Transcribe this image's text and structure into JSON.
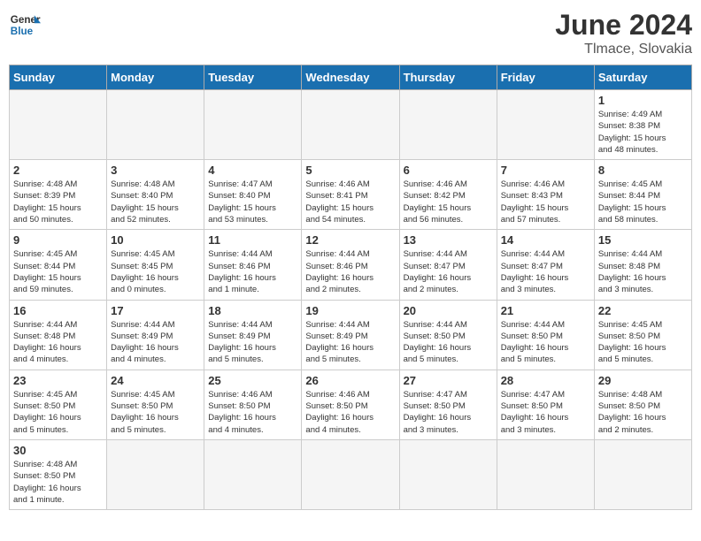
{
  "header": {
    "logo_general": "General",
    "logo_blue": "Blue",
    "title": "June 2024",
    "subtitle": "Tlmace, Slovakia"
  },
  "weekdays": [
    "Sunday",
    "Monday",
    "Tuesday",
    "Wednesday",
    "Thursday",
    "Friday",
    "Saturday"
  ],
  "weeks": [
    [
      {
        "day": "",
        "info": "",
        "empty": true
      },
      {
        "day": "",
        "info": "",
        "empty": true
      },
      {
        "day": "",
        "info": "",
        "empty": true
      },
      {
        "day": "",
        "info": "",
        "empty": true
      },
      {
        "day": "",
        "info": "",
        "empty": true
      },
      {
        "day": "",
        "info": "",
        "empty": true
      },
      {
        "day": "1",
        "info": "Sunrise: 4:49 AM\nSunset: 8:38 PM\nDaylight: 15 hours\nand 48 minutes."
      }
    ],
    [
      {
        "day": "2",
        "info": "Sunrise: 4:48 AM\nSunset: 8:39 PM\nDaylight: 15 hours\nand 50 minutes."
      },
      {
        "day": "3",
        "info": "Sunrise: 4:48 AM\nSunset: 8:40 PM\nDaylight: 15 hours\nand 52 minutes."
      },
      {
        "day": "4",
        "info": "Sunrise: 4:47 AM\nSunset: 8:40 PM\nDaylight: 15 hours\nand 53 minutes."
      },
      {
        "day": "5",
        "info": "Sunrise: 4:46 AM\nSunset: 8:41 PM\nDaylight: 15 hours\nand 54 minutes."
      },
      {
        "day": "6",
        "info": "Sunrise: 4:46 AM\nSunset: 8:42 PM\nDaylight: 15 hours\nand 56 minutes."
      },
      {
        "day": "7",
        "info": "Sunrise: 4:46 AM\nSunset: 8:43 PM\nDaylight: 15 hours\nand 57 minutes."
      },
      {
        "day": "8",
        "info": "Sunrise: 4:45 AM\nSunset: 8:44 PM\nDaylight: 15 hours\nand 58 minutes."
      }
    ],
    [
      {
        "day": "9",
        "info": "Sunrise: 4:45 AM\nSunset: 8:44 PM\nDaylight: 15 hours\nand 59 minutes."
      },
      {
        "day": "10",
        "info": "Sunrise: 4:45 AM\nSunset: 8:45 PM\nDaylight: 16 hours\nand 0 minutes."
      },
      {
        "day": "11",
        "info": "Sunrise: 4:44 AM\nSunset: 8:46 PM\nDaylight: 16 hours\nand 1 minute."
      },
      {
        "day": "12",
        "info": "Sunrise: 4:44 AM\nSunset: 8:46 PM\nDaylight: 16 hours\nand 2 minutes."
      },
      {
        "day": "13",
        "info": "Sunrise: 4:44 AM\nSunset: 8:47 PM\nDaylight: 16 hours\nand 2 minutes."
      },
      {
        "day": "14",
        "info": "Sunrise: 4:44 AM\nSunset: 8:47 PM\nDaylight: 16 hours\nand 3 minutes."
      },
      {
        "day": "15",
        "info": "Sunrise: 4:44 AM\nSunset: 8:48 PM\nDaylight: 16 hours\nand 3 minutes."
      }
    ],
    [
      {
        "day": "16",
        "info": "Sunrise: 4:44 AM\nSunset: 8:48 PM\nDaylight: 16 hours\nand 4 minutes."
      },
      {
        "day": "17",
        "info": "Sunrise: 4:44 AM\nSunset: 8:49 PM\nDaylight: 16 hours\nand 4 minutes."
      },
      {
        "day": "18",
        "info": "Sunrise: 4:44 AM\nSunset: 8:49 PM\nDaylight: 16 hours\nand 5 minutes."
      },
      {
        "day": "19",
        "info": "Sunrise: 4:44 AM\nSunset: 8:49 PM\nDaylight: 16 hours\nand 5 minutes."
      },
      {
        "day": "20",
        "info": "Sunrise: 4:44 AM\nSunset: 8:50 PM\nDaylight: 16 hours\nand 5 minutes."
      },
      {
        "day": "21",
        "info": "Sunrise: 4:44 AM\nSunset: 8:50 PM\nDaylight: 16 hours\nand 5 minutes."
      },
      {
        "day": "22",
        "info": "Sunrise: 4:45 AM\nSunset: 8:50 PM\nDaylight: 16 hours\nand 5 minutes."
      }
    ],
    [
      {
        "day": "23",
        "info": "Sunrise: 4:45 AM\nSunset: 8:50 PM\nDaylight: 16 hours\nand 5 minutes."
      },
      {
        "day": "24",
        "info": "Sunrise: 4:45 AM\nSunset: 8:50 PM\nDaylight: 16 hours\nand 5 minutes."
      },
      {
        "day": "25",
        "info": "Sunrise: 4:46 AM\nSunset: 8:50 PM\nDaylight: 16 hours\nand 4 minutes."
      },
      {
        "day": "26",
        "info": "Sunrise: 4:46 AM\nSunset: 8:50 PM\nDaylight: 16 hours\nand 4 minutes."
      },
      {
        "day": "27",
        "info": "Sunrise: 4:47 AM\nSunset: 8:50 PM\nDaylight: 16 hours\nand 3 minutes."
      },
      {
        "day": "28",
        "info": "Sunrise: 4:47 AM\nSunset: 8:50 PM\nDaylight: 16 hours\nand 3 minutes."
      },
      {
        "day": "29",
        "info": "Sunrise: 4:48 AM\nSunset: 8:50 PM\nDaylight: 16 hours\nand 2 minutes."
      }
    ],
    [
      {
        "day": "30",
        "info": "Sunrise: 4:48 AM\nSunset: 8:50 PM\nDaylight: 16 hours\nand 1 minute.",
        "last": true
      },
      {
        "day": "",
        "info": "",
        "empty": true,
        "last": true
      },
      {
        "day": "",
        "info": "",
        "empty": true,
        "last": true
      },
      {
        "day": "",
        "info": "",
        "empty": true,
        "last": true
      },
      {
        "day": "",
        "info": "",
        "empty": true,
        "last": true
      },
      {
        "day": "",
        "info": "",
        "empty": true,
        "last": true
      },
      {
        "day": "",
        "info": "",
        "empty": true,
        "last": true
      }
    ]
  ]
}
